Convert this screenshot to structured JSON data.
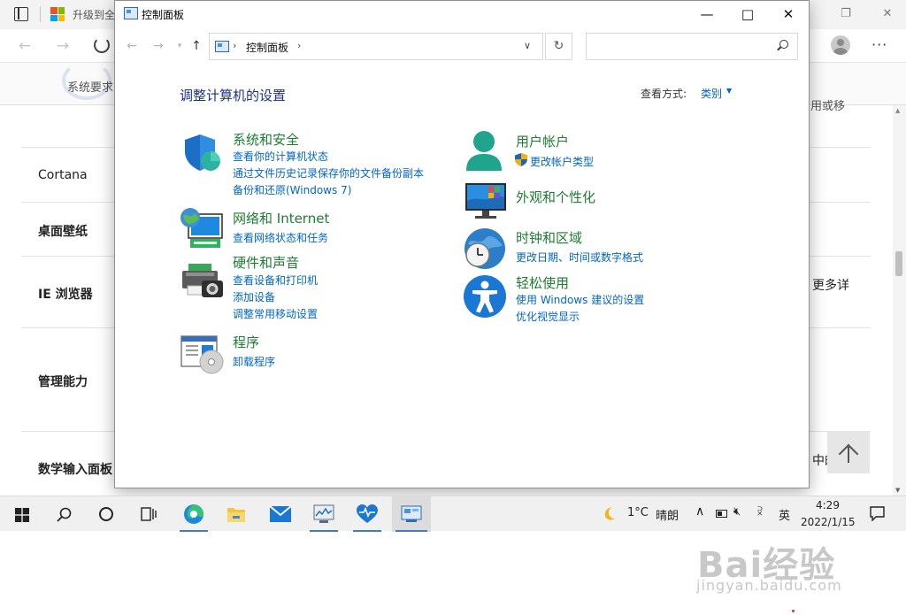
{
  "browser": {
    "tab_title": "升级到全",
    "banner_text": "系统要求",
    "banner_right_text": "用或移",
    "rows": [
      {
        "label": "Cortana"
      },
      {
        "label": "桌面壁纸"
      },
      {
        "label": "IE 浏览器"
      },
      {
        "label": "管理能力"
      },
      {
        "label": "数学输入面板"
      }
    ],
    "right_texts": [
      "更多详",
      "中的数"
    ]
  },
  "window": {
    "title": "控制面板",
    "address": {
      "path": "控制面板"
    },
    "search": {
      "value": "",
      "placeholder": ""
    },
    "heading": "调整计算机的设置",
    "view_label": "查看方式:",
    "view_value": "类别"
  },
  "categories": [
    {
      "title": "系统和安全",
      "icon": "shield-icon",
      "links": [
        "查看你的计算机状态",
        "通过文件历史记录保存你的文件备份副本",
        "备份和还原(Windows 7)"
      ]
    },
    {
      "title": "网络和 Internet",
      "icon": "network-globe-icon",
      "links": [
        "查看网络状态和任务"
      ]
    },
    {
      "title": "硬件和声音",
      "icon": "printer-camera-icon",
      "links": [
        "查看设备和打印机",
        "添加设备",
        "调整常用移动设置"
      ]
    },
    {
      "title": "程序",
      "icon": "program-disc-icon",
      "links": [
        "卸载程序"
      ]
    },
    {
      "title": "用户帐户",
      "icon": "user-icon",
      "links": [
        "更改帐户类型"
      ]
    },
    {
      "title": "外观和个性化",
      "icon": "monitor-icon",
      "links": []
    },
    {
      "title": "时钟和区域",
      "icon": "clock-globe-icon",
      "links": [
        "更改日期、时间或数字格式"
      ]
    },
    {
      "title": "轻松使用",
      "icon": "accessibility-icon",
      "links": [
        "使用 Windows 建议的设置",
        "优化视觉显示"
      ]
    }
  ],
  "taskbar": {
    "weather_temp": "1°C",
    "weather_text": "晴朗",
    "ime": "英",
    "time": "4:29",
    "date": "2022/1/15"
  },
  "watermark": {
    "logo": "Bai经验",
    "url": "jingyan.baidu.com"
  },
  "colors": {
    "category_title": "#1d7d32",
    "link": "#0066cc",
    "heading": "#1e3287",
    "taskbar_accent": "#3b7bd4"
  }
}
